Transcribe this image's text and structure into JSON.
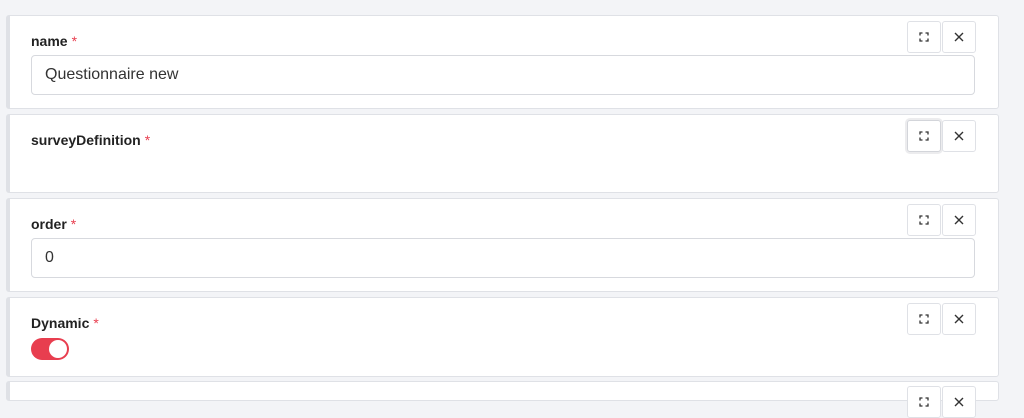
{
  "fields": [
    {
      "label": "name",
      "required_mark": "*",
      "value": "Questionnaire new"
    },
    {
      "label": "surveyDefinition",
      "required_mark": "*"
    },
    {
      "label": "order",
      "required_mark": "*",
      "value": "0"
    },
    {
      "label": "Dynamic",
      "required_mark": "*",
      "toggle_on": true
    }
  ],
  "icons": {
    "expand": "expand-icon",
    "remove": "close-icon"
  },
  "colors": {
    "toggle_on": "#e83e4f",
    "required": "#e83e4f",
    "card_border": "#dfe1e6",
    "background": "#f3f4f7"
  }
}
